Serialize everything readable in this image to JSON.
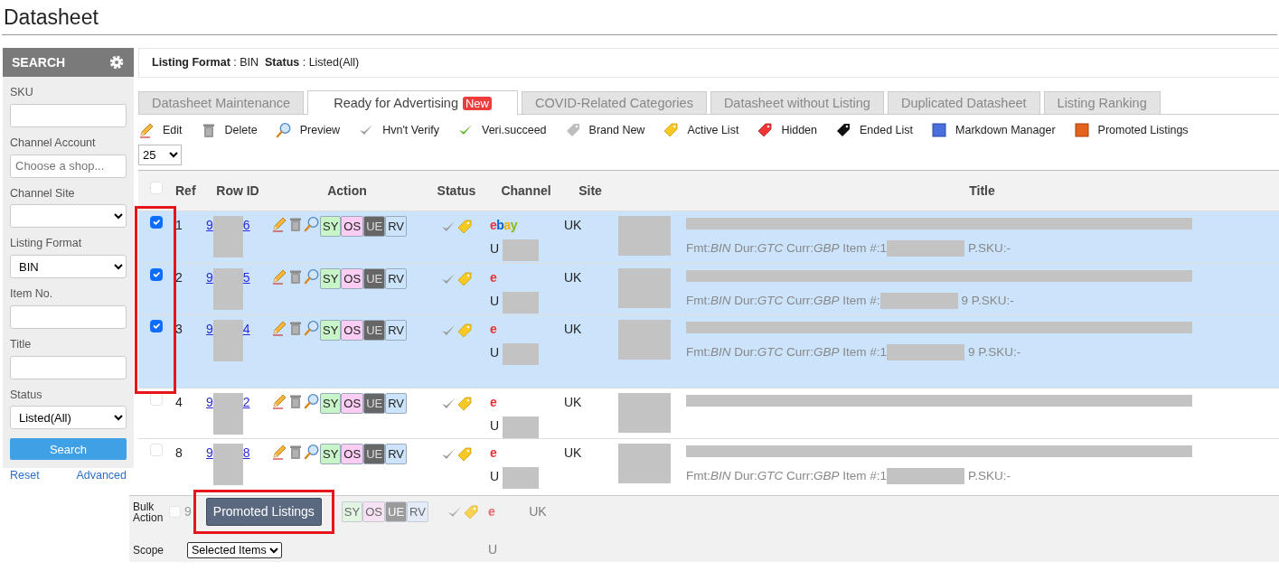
{
  "page_title": "Datasheet",
  "sidebar": {
    "title": "SEARCH",
    "fields": [
      {
        "kind": "input",
        "label": "SKU"
      },
      {
        "kind": "input",
        "label": "Channel Account",
        "placeholder": "Choose a shop..."
      },
      {
        "kind": "select",
        "label": "Channel Site"
      },
      {
        "kind": "select",
        "label": "Listing Format",
        "value": "BIN"
      },
      {
        "kind": "input",
        "label": "Item No."
      },
      {
        "kind": "input",
        "label": "Title"
      },
      {
        "kind": "select",
        "label": "Status",
        "value": "Listed(All)"
      }
    ],
    "search_button": "Search",
    "reset_link": "Reset",
    "advanced_link": "Advanced"
  },
  "filter_summary": "**Listing Format** : BIN  **Status** : Listed(All)",
  "tabs": [
    {
      "label": "Datasheet Maintenance",
      "selected": false
    },
    {
      "label": "Ready for Advertising",
      "badge": "New",
      "selected": true
    },
    {
      "label": "COVID-Related Categories",
      "selected": false
    },
    {
      "label": "Datasheet without Listing",
      "selected": false
    },
    {
      "label": "Duplicated Datasheet",
      "selected": false
    },
    {
      "label": "Listing Ranking",
      "selected": false
    }
  ],
  "legend": [
    {
      "kind": "edit",
      "label": "Edit"
    },
    {
      "kind": "delete",
      "label": "Delete"
    },
    {
      "kind": "preview",
      "label": "Preview"
    },
    {
      "kind": "unverified",
      "label": "Hvn't Verify"
    },
    {
      "kind": "verified",
      "label": "Veri.succeed"
    },
    {
      "kind": "brand-new",
      "label": "Brand New"
    },
    {
      "kind": "active",
      "label": "Active List"
    },
    {
      "kind": "hidden",
      "label": "Hidden"
    },
    {
      "kind": "ended",
      "label": "Ended List"
    },
    {
      "kind": "markdown",
      "label": "Markdown Manager"
    },
    {
      "kind": "promoted",
      "label": "Promoted Listings"
    }
  ],
  "page_size": "25",
  "table": {
    "columns": [
      "Ref",
      "Row ID",
      "Action",
      "Status",
      "Channel",
      "Site",
      "Title"
    ],
    "header_checked": false,
    "rows": [
      {
        "checked": true,
        "ref": "1",
        "id_start": "9",
        "id_end": "6",
        "actions": [
          {
            "label": "SY",
            "color": "#c8f5c8"
          },
          {
            "label": "OS",
            "color": "#fbcdf3"
          },
          {
            "label": "UE",
            "color": "#666666"
          },
          {
            "label": "RV",
            "color": "#cce4fb"
          }
        ],
        "status": [
          {
            "kind": "unverified"
          },
          {
            "kind": "active"
          }
        ],
        "channel": "ebay",
        "account": "U",
        "site": "UK",
        "meta_start": "Fmt:*BIN* Dur:*GTC* Curr:*GBP* Item #:1",
        "meta_end": "P.SKU:-"
      },
      {
        "checked": true,
        "ref": "2",
        "id_start": "9",
        "id_end": "5",
        "actions": [
          {
            "label": "SY",
            "color": "#c8f5c8"
          },
          {
            "label": "OS",
            "color": "#fbcdf3"
          },
          {
            "label": "UE",
            "color": "#666666"
          },
          {
            "label": "RV",
            "color": "#cce4fb"
          }
        ],
        "status": [
          {
            "kind": "unverified"
          },
          {
            "kind": "active"
          }
        ],
        "channel": "e",
        "account": "U",
        "site": "UK",
        "meta_start": "Fmt:*BIN* Dur:*GTC* Curr:*GBP* Item #:",
        "meta_end": "9 P.SKU:-"
      },
      {
        "checked": true,
        "ref": "3",
        "id_start": "9",
        "id_end": "4",
        "actions": [
          {
            "label": "SY",
            "color": "#c8f5c8"
          },
          {
            "label": "OS",
            "color": "#fbcdf3"
          },
          {
            "label": "UE",
            "color": "#666666"
          },
          {
            "label": "RV",
            "color": "#cce4fb"
          }
        ],
        "status": [
          {
            "kind": "unverified"
          },
          {
            "kind": "active"
          }
        ],
        "channel": "e",
        "account": "U",
        "site": "UK",
        "meta_start": "Fmt:*BIN* Dur:*GTC* Curr:*GBP* Item #:1",
        "meta_end": "9 P.SKU:-"
      },
      {
        "checked": false,
        "ref": "4",
        "id_start": "9",
        "id_end": "2",
        "actions": [
          {
            "label": "SY",
            "color": "#c8f5c8"
          },
          {
            "label": "OS",
            "color": "#fbcdf3"
          },
          {
            "label": "UE",
            "color": "#666666"
          },
          {
            "label": "RV",
            "color": "#cce4fb"
          }
        ],
        "status": [
          {
            "kind": "unverified"
          },
          {
            "kind": "active"
          }
        ],
        "channel": "e",
        "account": "U",
        "site": "UK"
      },
      {
        "checked": false,
        "ref": "8",
        "id_start": "9",
        "id_end": "8",
        "actions": [
          {
            "label": "SY",
            "color": "#c8f5c8"
          },
          {
            "label": "OS",
            "color": "#fbcdf3"
          },
          {
            "label": "UE",
            "color": "#666666"
          },
          {
            "label": "RV",
            "color": "#cce4fb"
          }
        ],
        "status": [
          {
            "kind": "unverified"
          },
          {
            "kind": "active"
          }
        ],
        "channel": "e",
        "account": "U",
        "site": "UK",
        "meta_start": "Fmt:*BIN* Dur:*GTC* Curr:*GBP* Item #:1",
        "meta_end": "P.SKU:-"
      },
      {
        "faded": true,
        "checked": false,
        "ref": "9",
        "actions": [
          {
            "label": "SY",
            "color": "#e2f4e2"
          },
          {
            "label": "OS",
            "color": "#f6e2f2"
          },
          {
            "label": "UE",
            "color": "#9b9b9b"
          },
          {
            "label": "RV",
            "color": "#e3ecf6"
          }
        ],
        "status": [
          {
            "kind": "unverified"
          },
          {
            "kind": "active"
          }
        ],
        "channel": "e",
        "account": "U",
        "site": "UK"
      }
    ]
  },
  "bulk_bar": {
    "action_label": "Bulk Action",
    "action_button": "Promoted Listings",
    "scope_label": "Scope",
    "scope_value": "Selected Items"
  }
}
